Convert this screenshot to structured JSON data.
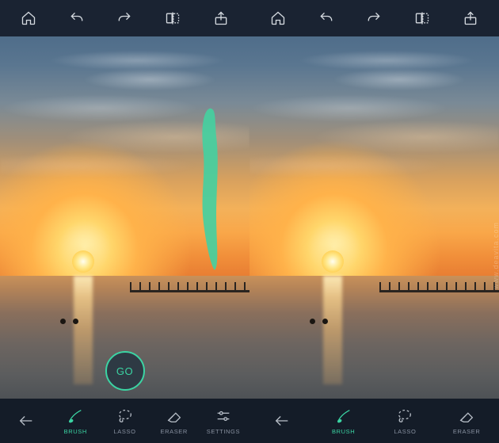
{
  "accent_color": "#3bd4a3",
  "top_toolbar": {
    "items": [
      {
        "name": "home-icon"
      },
      {
        "name": "undo-icon"
      },
      {
        "name": "redo-icon"
      },
      {
        "name": "compare-icon"
      },
      {
        "name": "share-icon"
      }
    ]
  },
  "go_button": {
    "label": "GO"
  },
  "bottom_toolbar": {
    "back": {
      "name": "back-arrow-icon"
    },
    "items": [
      {
        "name": "brush",
        "label": "BRUSH",
        "active": true
      },
      {
        "name": "lasso",
        "label": "LASSO",
        "active": false
      },
      {
        "name": "eraser",
        "label": "ERASER",
        "active": false
      },
      {
        "name": "settings",
        "label": "SETTINGS",
        "active": false
      }
    ]
  },
  "right_bottom_toolbar": {
    "back": {
      "name": "back-arrow-icon"
    },
    "items": [
      {
        "name": "brush",
        "label": "BRUSH",
        "active": true
      },
      {
        "name": "lasso",
        "label": "LASSO",
        "active": false
      },
      {
        "name": "eraser",
        "label": "ERASER",
        "active": false
      }
    ]
  },
  "watermark": "www.deavita.com"
}
